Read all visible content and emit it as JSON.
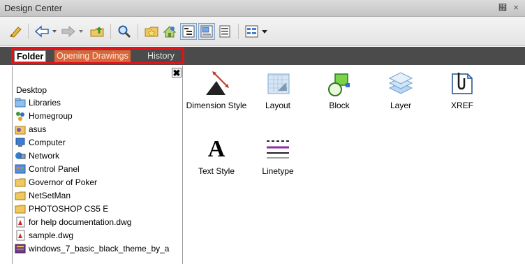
{
  "window": {
    "title": "Design Center",
    "pin_glyph": "๯",
    "close_glyph": "×"
  },
  "toolbar": {
    "buttons": [
      "load-icon",
      "back-icon",
      "forward-icon",
      "up-icon",
      "search-icon",
      "favorites-icon",
      "home-icon",
      "tree-view-icon",
      "preview-icon",
      "description-icon",
      "views-icon"
    ]
  },
  "tabs": [
    {
      "label": "Folder",
      "state": "active"
    },
    {
      "label": "Opening Drawings",
      "state": "inactive"
    },
    {
      "label": "History",
      "state": "inactive"
    }
  ],
  "tree": {
    "close_glyph": "✖",
    "root": "Desktop",
    "items": [
      {
        "label": "Libraries",
        "icon": "libraries-icon"
      },
      {
        "label": "Homegroup",
        "icon": "homegroup-icon"
      },
      {
        "label": "asus",
        "icon": "user-folder-icon"
      },
      {
        "label": "Computer",
        "icon": "computer-icon"
      },
      {
        "label": "Network",
        "icon": "network-icon"
      },
      {
        "label": "Control Panel",
        "icon": "control-panel-icon"
      },
      {
        "label": "Governor of Poker",
        "icon": "folder-icon"
      },
      {
        "label": "NetSetMan",
        "icon": "folder-icon"
      },
      {
        "label": "PHOTOSHOP CS5 E",
        "icon": "folder-icon"
      },
      {
        "label": "for help documentation.dwg",
        "icon": "dwg-file-icon"
      },
      {
        "label": "sample.dwg",
        "icon": "dwg-file-icon"
      },
      {
        "label": "windows_7_basic_black_theme_by_a",
        "icon": "archive-icon"
      }
    ]
  },
  "content": {
    "items": [
      {
        "label": "Dimension Style",
        "icon": "dimension-style-icon"
      },
      {
        "label": "Layout",
        "icon": "layout-icon"
      },
      {
        "label": "Block",
        "icon": "block-icon"
      },
      {
        "label": "Layer",
        "icon": "layer-icon"
      },
      {
        "label": "XREF",
        "icon": "xref-icon"
      },
      {
        "label": "Text Style",
        "icon": "text-style-icon",
        "glyph": "A"
      },
      {
        "label": "Linetype",
        "icon": "linetype-icon"
      }
    ]
  },
  "colors": {
    "tab_highlight": "#e2141a",
    "tab_orange": "#d9663a",
    "tabbar_bg": "#4b4b4b"
  }
}
